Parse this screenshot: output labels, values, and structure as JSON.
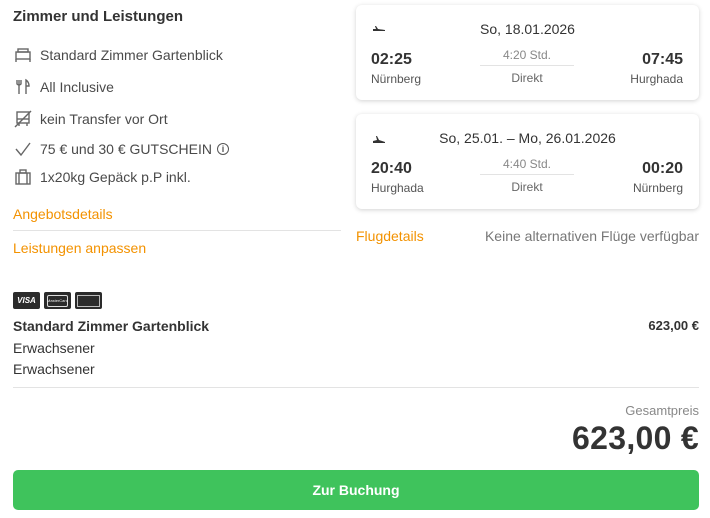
{
  "section_title": "Zimmer und Leistungen",
  "features": [
    {
      "icon": "bed-icon",
      "text": "Standard Zimmer Gartenblick"
    },
    {
      "icon": "cutlery-icon",
      "text": "All Inclusive"
    },
    {
      "icon": "no-transfer-icon",
      "text": "kein Transfer vor Ort"
    },
    {
      "icon": "checkmark-icon",
      "text": "75 € und 30 € GUTSCHEIN"
    },
    {
      "icon": "luggage-icon",
      "text": "1x20kg Gepäck p.P inkl."
    }
  ],
  "links": {
    "offer_details": "Angebotsdetails",
    "customize": "Leistungen anpassen",
    "flight_details": "Flugdetails"
  },
  "flights": [
    {
      "date": "So, 18.01.2026",
      "departure_time": "02:25",
      "departure_city": "Nürnberg",
      "duration": "4:20 Std.",
      "type": "Direkt",
      "arrival_time": "07:45",
      "arrival_city": "Hurghada"
    },
    {
      "date": "So, 25.01. – Mo, 26.01.2026",
      "departure_time": "20:40",
      "departure_city": "Hurghada",
      "duration": "4:40 Std.",
      "type": "Direkt",
      "arrival_time": "00:20",
      "arrival_city": "Nürnberg"
    }
  ],
  "no_alternatives": "Keine alternativen Flüge verfügbar",
  "payment": {
    "visa_label": "VISA",
    "mastercard_label": "MasterCard"
  },
  "summary": {
    "room_name": "Standard Zimmer Gartenblick",
    "room_price": "623,00 €",
    "travellers": [
      "Erwachsener",
      "Erwachsener"
    ],
    "total_label": "Gesamtpreis",
    "total_value": "623,00 €"
  },
  "book_button": "Zur Buchung",
  "colors": {
    "accent_orange": "#f39200",
    "button_green": "#3fc35c"
  }
}
